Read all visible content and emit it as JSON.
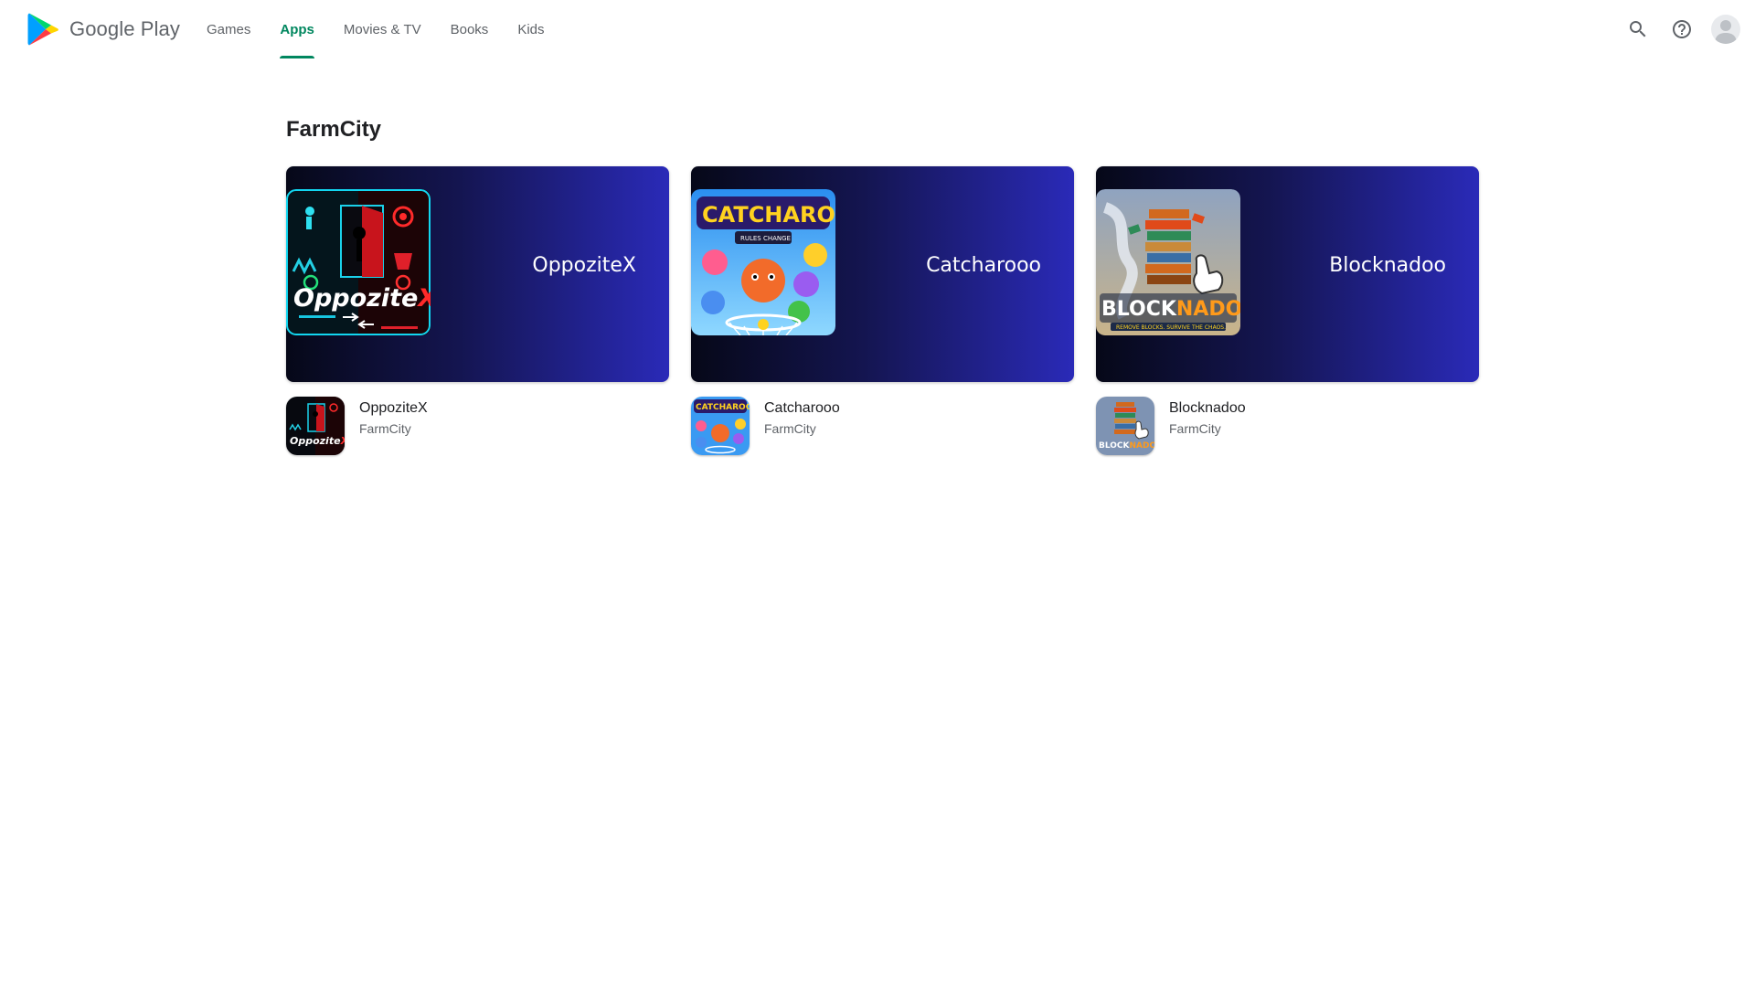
{
  "header": {
    "brand": "Google Play",
    "nav": [
      {
        "label": "Games",
        "active": false
      },
      {
        "label": "Apps",
        "active": true
      },
      {
        "label": "Movies & TV",
        "active": false
      },
      {
        "label": "Books",
        "active": false
      },
      {
        "label": "Kids",
        "active": false
      }
    ],
    "actions": {
      "search_icon": "search-icon",
      "help_icon": "help-icon",
      "account_icon": "account-avatar"
    }
  },
  "colors": {
    "accent": "#01875f",
    "banner_dark": "#060818",
    "banner_light": "#2a2ab8"
  },
  "section": {
    "title": "FarmCity",
    "apps": [
      {
        "banner_title": "OppoziteX",
        "name": "OppoziteX",
        "developer": "FarmCity",
        "art_text": "OppoziteX"
      },
      {
        "banner_title": "Catcharooo",
        "name": "Catcharooo",
        "developer": "FarmCity",
        "art_text": "CATCHAROOO!"
      },
      {
        "banner_title": "Blocknadoo",
        "name": "Blocknadoo",
        "developer": "FarmCity",
        "art_text": "BLOCKNADOO"
      }
    ]
  }
}
